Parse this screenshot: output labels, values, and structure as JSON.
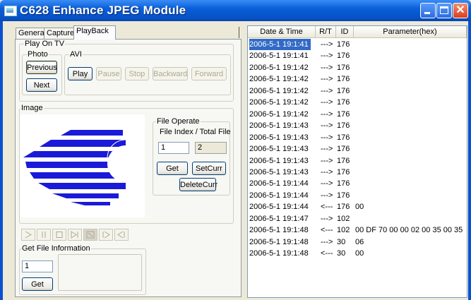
{
  "window": {
    "title": "C628 Enhance JPEG Module"
  },
  "tabs": [
    "General",
    "Capture",
    "PlayBack"
  ],
  "play_on_tv": {
    "label": "Play On TV",
    "photo": {
      "label": "Photo",
      "previous": "Previous",
      "next": "Next"
    },
    "avi": {
      "label": "AVI",
      "play": "Play",
      "pause": "Pause",
      "stop": "Stop",
      "backward": "Backward",
      "forward": "Forward"
    }
  },
  "image_group": {
    "label": "Image"
  },
  "file_operate": {
    "label": "File Operate",
    "index_label": "File Index  / Total File",
    "index_value": "1",
    "total_value": "2",
    "get": "Get",
    "set_curr": "SetCurr",
    "delete_curr": "DeleteCurr"
  },
  "transport": [
    "|>",
    "||",
    "[]",
    ">|",
    "[]",
    "|>",
    "<|"
  ],
  "get_file_info": {
    "label": "Get File Information",
    "value": "1",
    "get": "Get"
  },
  "log": {
    "columns": [
      "Date & Time",
      "R/T",
      "ID",
      "Parameter(hex)"
    ],
    "rows": [
      {
        "dt": "2006-5-1  19:1:41",
        "rt": "--->",
        "id": "176",
        "param": "",
        "sel": true
      },
      {
        "dt": "2006-5-1  19:1:41",
        "rt": "--->",
        "id": "176",
        "param": ""
      },
      {
        "dt": "2006-5-1  19:1:42",
        "rt": "--->",
        "id": "176",
        "param": ""
      },
      {
        "dt": "2006-5-1  19:1:42",
        "rt": "--->",
        "id": "176",
        "param": ""
      },
      {
        "dt": "2006-5-1  19:1:42",
        "rt": "--->",
        "id": "176",
        "param": ""
      },
      {
        "dt": "2006-5-1  19:1:42",
        "rt": "--->",
        "id": "176",
        "param": ""
      },
      {
        "dt": "2006-5-1  19:1:42",
        "rt": "--->",
        "id": "176",
        "param": ""
      },
      {
        "dt": "2006-5-1  19:1:43",
        "rt": "--->",
        "id": "176",
        "param": ""
      },
      {
        "dt": "2006-5-1  19:1:43",
        "rt": "--->",
        "id": "176",
        "param": ""
      },
      {
        "dt": "2006-5-1  19:1:43",
        "rt": "--->",
        "id": "176",
        "param": ""
      },
      {
        "dt": "2006-5-1  19:1:43",
        "rt": "--->",
        "id": "176",
        "param": ""
      },
      {
        "dt": "2006-5-1  19:1:43",
        "rt": "--->",
        "id": "176",
        "param": ""
      },
      {
        "dt": "2006-5-1  19:1:44",
        "rt": "--->",
        "id": "176",
        "param": ""
      },
      {
        "dt": "2006-5-1  19:1:44",
        "rt": "--->",
        "id": "176",
        "param": ""
      },
      {
        "dt": "2006-5-1  19:1:44",
        "rt": "<---",
        "id": "176",
        "param": "00"
      },
      {
        "dt": "2006-5-1  19:1:47",
        "rt": "--->",
        "id": "102",
        "param": ""
      },
      {
        "dt": "2006-5-1  19:1:48",
        "rt": "<---",
        "id": "102",
        "param": "00 DF 70 00 00 02 00 35 00 35"
      },
      {
        "dt": "2006-5-1  19:1:48",
        "rt": "--->",
        "id": "30",
        "param": "06"
      },
      {
        "dt": "2006-5-1  19:1:48",
        "rt": "<---",
        "id": "30",
        "param": "00"
      }
    ]
  },
  "colors": {
    "titlebar": "#0a5fd8",
    "selection": "#316ac5",
    "logo_blue": "#1a1ad8"
  }
}
